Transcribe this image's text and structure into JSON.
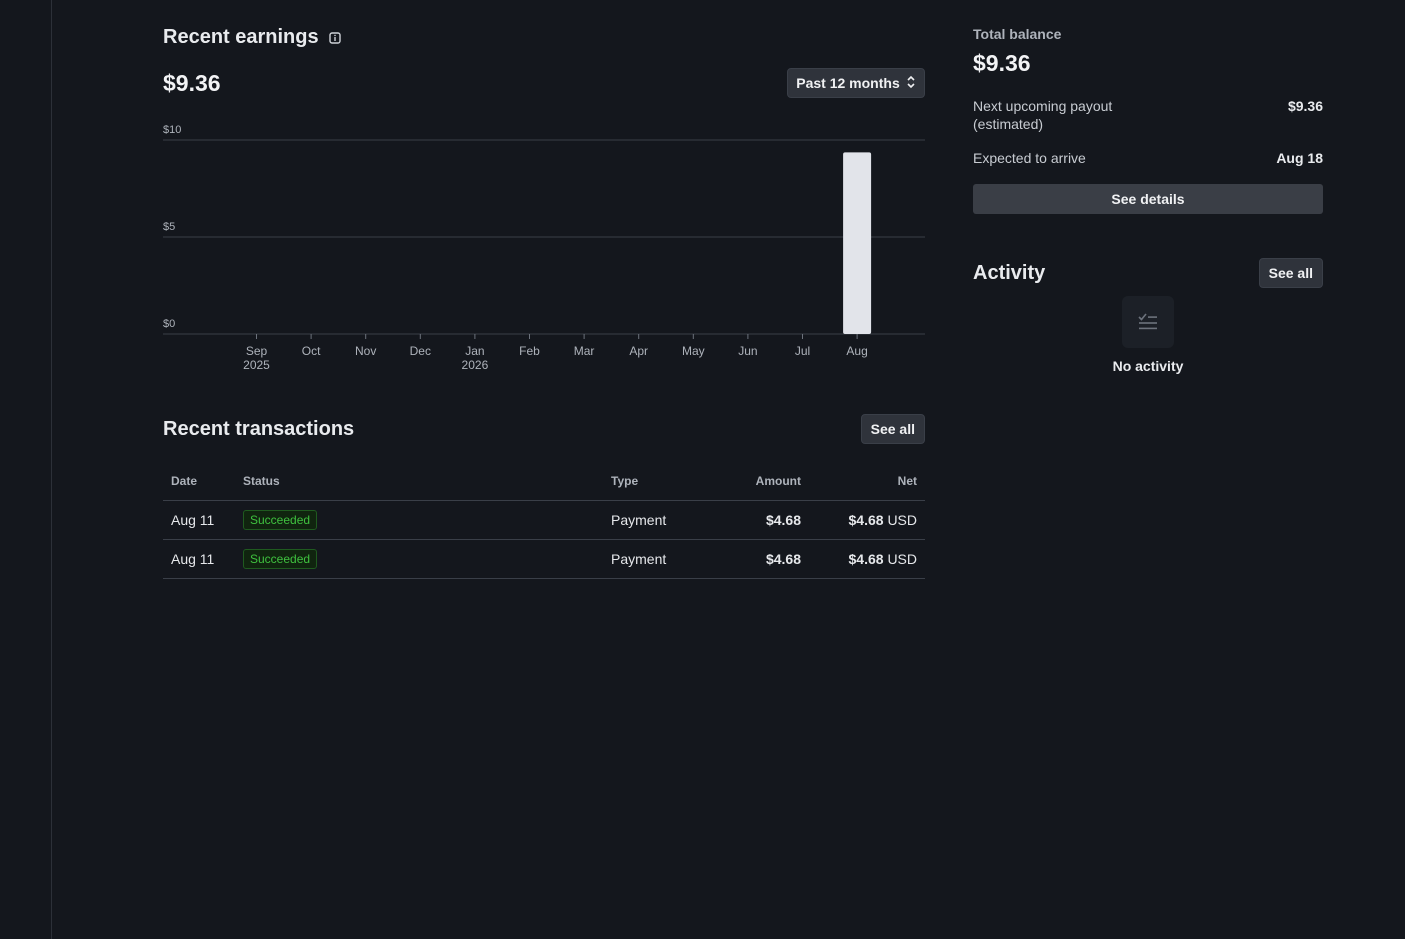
{
  "earnings": {
    "title": "Recent earnings",
    "total": "$9.36",
    "range_button": "Past 12 months"
  },
  "chart_data": {
    "type": "bar",
    "categories": [
      "Sep",
      "Oct",
      "Nov",
      "Dec",
      "Jan",
      "Feb",
      "Mar",
      "Apr",
      "May",
      "Jun",
      "Jul",
      "Aug"
    ],
    "category_sublabels": [
      "2025",
      "",
      "",
      "",
      "2026",
      "",
      "",
      "",
      "",
      "",
      "",
      ""
    ],
    "values": [
      0,
      0,
      0,
      0,
      0,
      0,
      0,
      0,
      0,
      0,
      0,
      9.36
    ],
    "yticks": [
      "$10",
      "$5",
      "$0"
    ],
    "ylim": [
      0,
      10
    ],
    "grid": true,
    "title": "",
    "xlabel": "",
    "ylabel": ""
  },
  "transactions": {
    "title": "Recent transactions",
    "see_all": "See all",
    "columns": {
      "date": "Date",
      "status": "Status",
      "type": "Type",
      "amount": "Amount",
      "net": "Net"
    },
    "rows": [
      {
        "date": "Aug 11",
        "status": "Succeeded",
        "type": "Payment",
        "amount": "$4.68",
        "net_value": "$4.68",
        "net_currency": "USD"
      },
      {
        "date": "Aug 11",
        "status": "Succeeded",
        "type": "Payment",
        "amount": "$4.68",
        "net_value": "$4.68",
        "net_currency": "USD"
      }
    ]
  },
  "balance": {
    "label": "Total balance",
    "value": "$9.36",
    "payout_label_line1": "Next upcoming payout",
    "payout_label_line2": "(estimated)",
    "payout_value": "$9.36",
    "arrive_label": "Expected to arrive",
    "arrive_value": "Aug 18",
    "see_details": "See details"
  },
  "activity": {
    "title": "Activity",
    "see_all": "See all",
    "empty": "No activity",
    "empty_icon": "checklist-icon"
  },
  "colors": {
    "background": "#14171d",
    "bar": "#e2e4ea",
    "success": "#3fc13f"
  }
}
